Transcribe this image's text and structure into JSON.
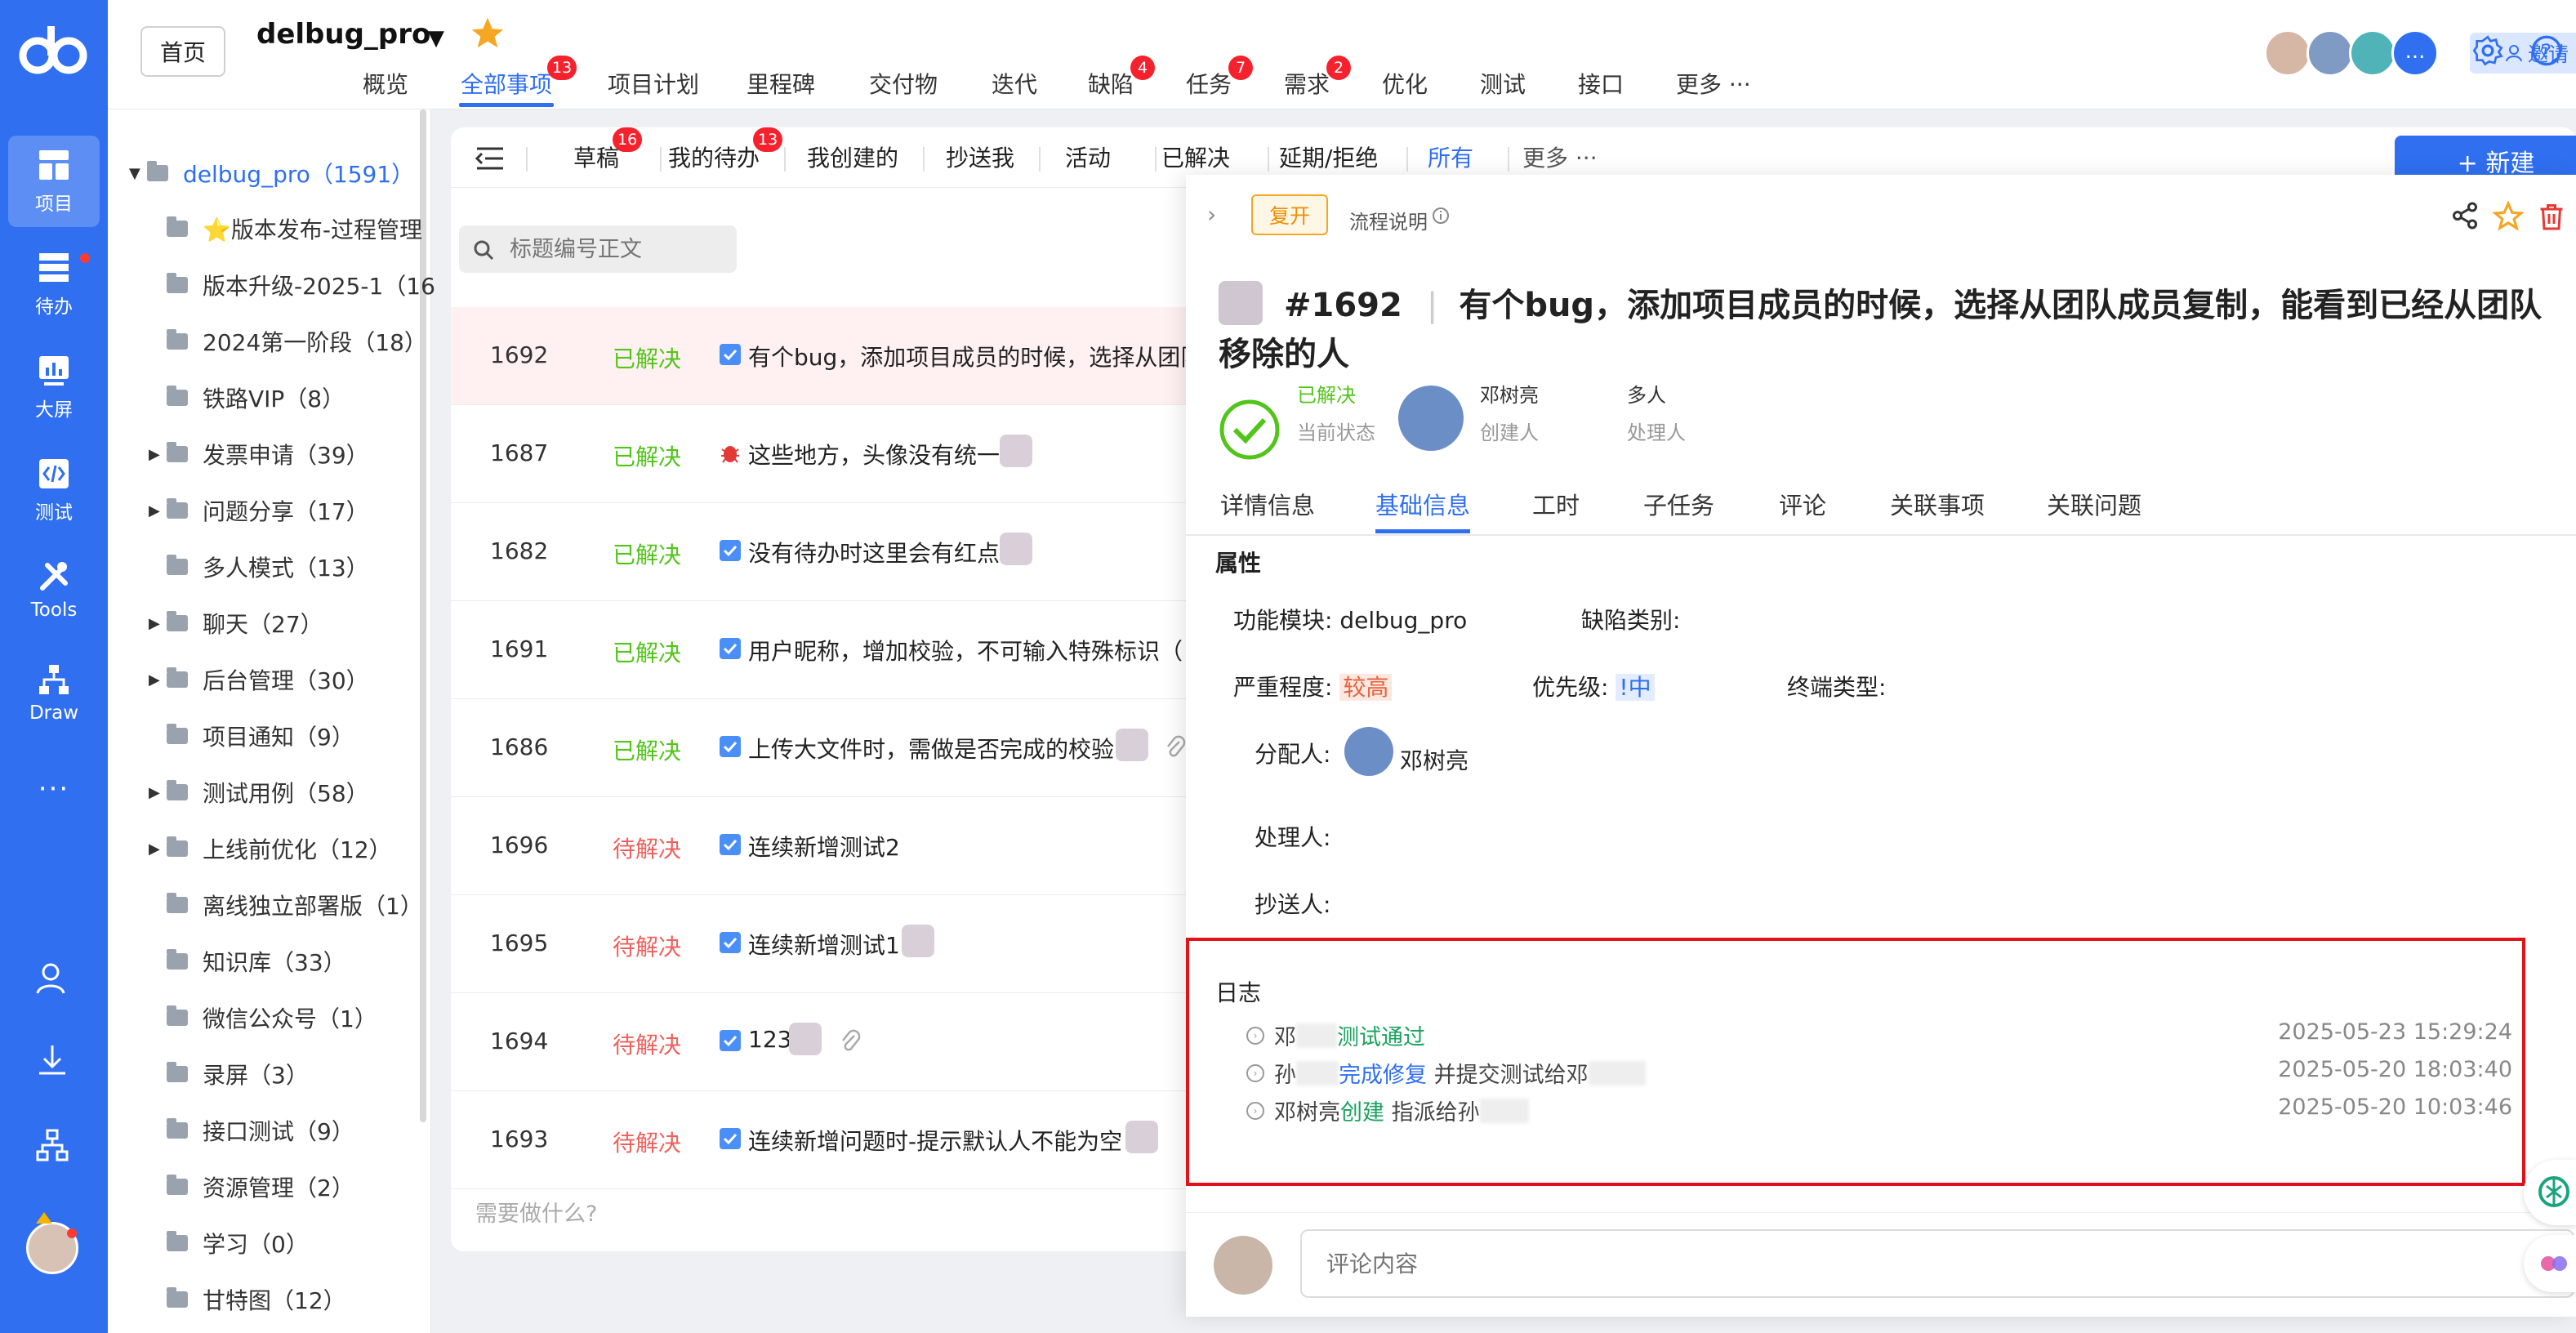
{
  "rail": {
    "items": [
      {
        "label": "项目",
        "icon": "project-icon"
      },
      {
        "label": "待办",
        "icon": "todo-icon"
      },
      {
        "label": "大屏",
        "icon": "dashboard-icon"
      },
      {
        "label": "测试",
        "icon": "code-icon"
      },
      {
        "label": "Tools",
        "icon": "tools-icon"
      },
      {
        "label": "Draw",
        "icon": "org-chart-icon"
      }
    ],
    "more": "···"
  },
  "header": {
    "home": "首页",
    "project": "delbug_pro",
    "tabs": [
      {
        "label": "概览"
      },
      {
        "label": "全部事项",
        "badge": "13"
      },
      {
        "label": "项目计划"
      },
      {
        "label": "里程碑"
      },
      {
        "label": "交付物"
      },
      {
        "label": "迭代"
      },
      {
        "label": "缺陷",
        "badge": "4"
      },
      {
        "label": "任务",
        "badge": "7"
      },
      {
        "label": "需求",
        "badge": "2"
      },
      {
        "label": "优化"
      },
      {
        "label": "测试"
      },
      {
        "label": "接口"
      },
      {
        "label": "更多 ···"
      }
    ],
    "avatar_more": "...",
    "invite": "邀请"
  },
  "tree": {
    "items": [
      {
        "label": "delbug_pro（1591）"
      },
      {
        "label": "⭐版本发布-过程管理"
      },
      {
        "label": "版本升级-2025-1（16"
      },
      {
        "label": "2024第一阶段（18）"
      },
      {
        "label": "铁路VIP（8）"
      },
      {
        "label": "发票申请（39）"
      },
      {
        "label": "问题分享（17）"
      },
      {
        "label": "多人模式（13）"
      },
      {
        "label": "聊天（27）"
      },
      {
        "label": "后台管理（30）"
      },
      {
        "label": "项目通知（9）"
      },
      {
        "label": "测试用例（58）"
      },
      {
        "label": "上线前优化（12）"
      },
      {
        "label": "离线独立部署版（1）"
      },
      {
        "label": "知识库（33）"
      },
      {
        "label": "微信公众号（1）"
      },
      {
        "label": "录屏（3）"
      },
      {
        "label": "接口测试（9）"
      },
      {
        "label": "资源管理（2）"
      },
      {
        "label": "学习（0）"
      },
      {
        "label": "甘特图（12）"
      }
    ]
  },
  "filters": {
    "tabs": [
      {
        "label": "草稿",
        "badge": "16"
      },
      {
        "label": "我的待办",
        "badge": "13"
      },
      {
        "label": "我创建的"
      },
      {
        "label": "抄送我"
      },
      {
        "label": "活动"
      },
      {
        "label": "已解决"
      },
      {
        "label": "延期/拒绝"
      },
      {
        "label": "所有"
      },
      {
        "label": "更多 ···"
      }
    ],
    "new_button": "+ 新建",
    "search_placeholder": "标题编号正文"
  },
  "list": {
    "rows": [
      {
        "id": "1692",
        "status": "已解决",
        "title": "有个bug，添加项目成员的时候，选择从团队"
      },
      {
        "id": "1687",
        "status": "已解决",
        "title": "这些地方，头像没有统一"
      },
      {
        "id": "1682",
        "status": "已解决",
        "title": "没有待办时这里会有红点"
      },
      {
        "id": "1691",
        "status": "已解决",
        "title": "用户昵称，增加校验，不可输入特殊标识（"
      },
      {
        "id": "1686",
        "status": "已解决",
        "title": "上传大文件时，需做是否完成的校验"
      },
      {
        "id": "1696",
        "status": "待解决",
        "title": "连续新增测试2"
      },
      {
        "id": "1695",
        "status": "待解决",
        "title": "连续新增测试1"
      },
      {
        "id": "1694",
        "status": "待解决",
        "title": "123"
      },
      {
        "id": "1693",
        "status": "待解决",
        "title": "连续新增问题时-提示默认人不能为空"
      }
    ],
    "todo_placeholder": "需要做什么?"
  },
  "detail": {
    "reopen": "复开",
    "flow": "流程说明",
    "number": "#1692",
    "title": "有个bug，添加项目成员的时候，选择从团队成员复制，能看到已经从团队移除的人",
    "state_value": "已解决",
    "state_label": "当前状态",
    "creator_name": "邓树亮",
    "creator_label": "创建人",
    "handler_value": "多人",
    "handler_label": "处理人",
    "tabs": [
      "详情信息",
      "基础信息",
      "工时",
      "子任务",
      "评论",
      "关联事项",
      "关联问题"
    ],
    "props_title": "属性",
    "module_label": "功能模块:",
    "module_value": "delbug_pro",
    "defect_label": "缺陷类别:",
    "severity_label": "严重程度:",
    "severity_value": "较高",
    "priority_label": "优先级:",
    "priority_value": "!中",
    "terminal_label": "终端类型:",
    "assignee_label": "分配人:",
    "assignee_name": "邓树亮",
    "processor_label": "处理人:",
    "cc_label": "抄送人:",
    "log_title": "日志",
    "logs": [
      {
        "who": "邓",
        "action": "测试通过",
        "extra": "",
        "time": "2025-05-23 15:29:24"
      },
      {
        "who": "孙",
        "action": "完成修复",
        "extra": "并提交测试给邓",
        "time": "2025-05-20 18:03:40"
      },
      {
        "who": "邓树亮",
        "action": "创建",
        "extra": "指派给孙",
        "time": "2025-05-20 10:03:46"
      }
    ],
    "comment_placeholder": "评论内容"
  }
}
